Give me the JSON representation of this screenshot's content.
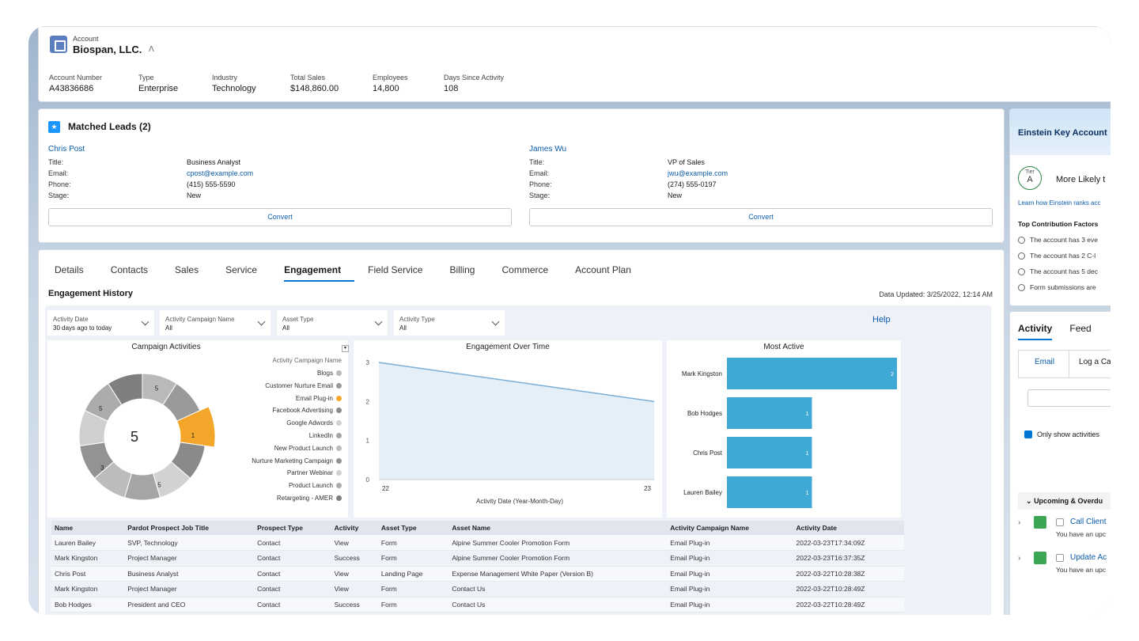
{
  "header": {
    "object_type": "Account",
    "account_name": "Biospan, LLC.",
    "fields": [
      {
        "label": "Account Number",
        "value": "A43836686"
      },
      {
        "label": "Type",
        "value": "Enterprise"
      },
      {
        "label": "Industry",
        "value": "Technology"
      },
      {
        "label": "Total Sales",
        "value": "$148,860.00"
      },
      {
        "label": "Employees",
        "value": "14,800"
      },
      {
        "label": "Days Since Activity",
        "value": "108"
      }
    ]
  },
  "matched_leads": {
    "title": "Matched Leads (2)",
    "leads": [
      {
        "name": "Chris Post",
        "title_label": "Title:",
        "title": "Business Analyst",
        "email_label": "Email:",
        "email": "cpost@example.com",
        "phone_label": "Phone:",
        "phone": "(415) 555-5590",
        "stage_label": "Stage:",
        "stage": "New",
        "convert": "Convert"
      },
      {
        "name": "James Wu",
        "title_label": "Title:",
        "title": "VP of Sales",
        "email_label": "Email:",
        "email": "jwu@example.com",
        "phone_label": "Phone:",
        "phone": "(274) 555-0197",
        "stage_label": "Stage:",
        "stage": "New",
        "convert": "Convert"
      }
    ]
  },
  "tabs": [
    "Details",
    "Contacts",
    "Sales",
    "Service",
    "Engagement",
    "Field Service",
    "Billing",
    "Commerce",
    "Account Plan"
  ],
  "active_tab": "Engagement",
  "engagement": {
    "title": "Engagement History",
    "data_updated": "Data Updated: 3/25/2022, 12:14 AM",
    "help": "Help",
    "filters": [
      {
        "label": "Activity Date",
        "value": "30 days ago to today"
      },
      {
        "label": "Activity Campaign Name",
        "value": "All"
      },
      {
        "label": "Asset Type",
        "value": "All"
      },
      {
        "label": "Activity Type",
        "value": "All"
      }
    ]
  },
  "chart_data": [
    {
      "type": "pie",
      "title": "Campaign Activities",
      "center_value": "5",
      "legend_title": "Activity Campaign Name",
      "categories": [
        "Blogs",
        "Customer Nurture Email",
        "Email Plug-in",
        "Facebook Advertising",
        "Google Adwords",
        "LinkedIn",
        "New Product Launch",
        "Nurture Marketing Campaign",
        "Partner Webinar",
        "Product Launch",
        "Retargeting - AMER"
      ],
      "slice_labels": [
        "5",
        "1",
        "5",
        "3",
        "5"
      ],
      "highlight": "Email Plug-in",
      "highlight_color": "#f4a62a"
    },
    {
      "type": "line",
      "title": "Engagement Over Time",
      "x": [
        "22",
        "23"
      ],
      "values": [
        3,
        2
      ],
      "xlabel": "Activity Date (Year-Month-Day)",
      "ylim": [
        0,
        3
      ],
      "yticks": [
        "3",
        "2",
        "1",
        "0"
      ]
    },
    {
      "type": "bar",
      "title": "Most Active",
      "categories": [
        "Mark Kingston",
        "Bob Hodges",
        "Chris Post",
        "Lauren Bailey"
      ],
      "values": [
        2,
        1,
        1,
        1
      ],
      "value_labels": [
        "2",
        "1",
        "1",
        "1"
      ],
      "color": "#3fa9d5"
    }
  ],
  "table": {
    "columns": [
      "Name",
      "Pardot Prospect Job Title",
      "Prospect Type",
      "Activity",
      "Asset Type",
      "Asset Name",
      "Activity Campaign Name",
      "Activity Date"
    ],
    "rows": [
      [
        "Lauren Bailey",
        "SVP, Technology",
        "Contact",
        "View",
        "Form",
        "Alpine Summer Cooler Promotion Form",
        "Email Plug-in",
        "2022-03-23T17:34:09Z"
      ],
      [
        "Mark Kingston",
        "Project Manager",
        "Contact",
        "Success",
        "Form",
        "Alpine Summer Cooler Promotion Form",
        "Email Plug-in",
        "2022-03-23T16:37:35Z"
      ],
      [
        "Chris Post",
        "Business Analyst",
        "Contact",
        "View",
        "Landing Page",
        "Expense Management White Paper (Version B)",
        "Email Plug-in",
        "2022-03-22T10:28:38Z"
      ],
      [
        "Mark Kingston",
        "Project Manager",
        "Contact",
        "View",
        "Form",
        "Contact Us",
        "Email Plug-in",
        "2022-03-22T10:28:49Z"
      ],
      [
        "Bob Hodges",
        "President and CEO",
        "Contact",
        "Success",
        "Form",
        "Contact Us",
        "Email Plug-in",
        "2022-03-22T10:28:49Z"
      ]
    ]
  },
  "einstein": {
    "title": "Einstein Key Account",
    "tier_label": "Tier",
    "tier": "A",
    "likely": "More Likely t",
    "learn": "Learn how Einstein ranks acc",
    "factors_title": "Top Contribution Factors",
    "factors": [
      "The account has 3 eve",
      "The account has 2 C-l",
      "The account has 5 dec",
      "Form submissions are"
    ]
  },
  "activity": {
    "tabs": [
      "Activity",
      "Feed"
    ],
    "sub_tabs": [
      "Email",
      "Log a Ca"
    ],
    "only_show": "Only show activities",
    "upcoming": "Upcoming & Overdu",
    "tasks": [
      {
        "title": "Call Client",
        "sub": "You have an upc"
      },
      {
        "title": "Update Ac",
        "sub": "You have an upc"
      }
    ]
  }
}
